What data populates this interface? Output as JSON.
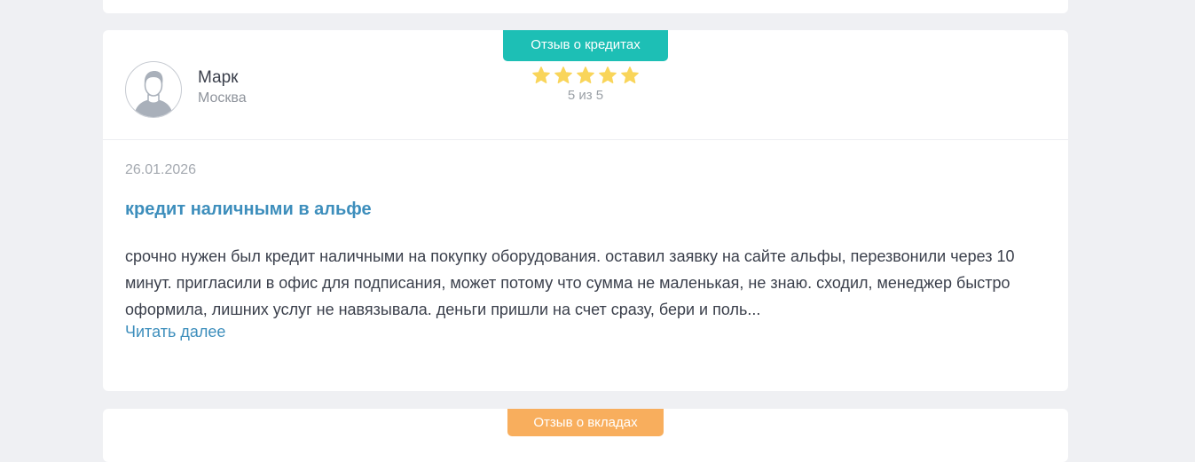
{
  "review": {
    "category_tag": "Отзыв о кредитах",
    "author": {
      "name": "Марк",
      "city": "Москва"
    },
    "rating": {
      "value": 5,
      "max": 5,
      "label": "5 из 5",
      "star_color": "#f9d55a"
    },
    "date": "26.01.2026",
    "title": "кредит наличными в альфе",
    "text": "срочно нужен был кредит наличными на покупку оборудования. оставил заявку на сайте альфы, перезвонили через 10 минут. пригласили в офис для подписания, может потому что сумма не маленькая, не знаю. сходил, менеджер быстро оформила, лишних услуг не навязывала. деньги пришли на счет сразу, бери и поль...",
    "read_more": "Читать далее"
  },
  "next_review": {
    "category_tag": "Отзыв о вкладах"
  },
  "colors": {
    "page_background": "#eff0f3",
    "credit_tag": "#1dbfb5",
    "deposit_tag": "#f8ae5d",
    "link": "#3d8ebc"
  }
}
